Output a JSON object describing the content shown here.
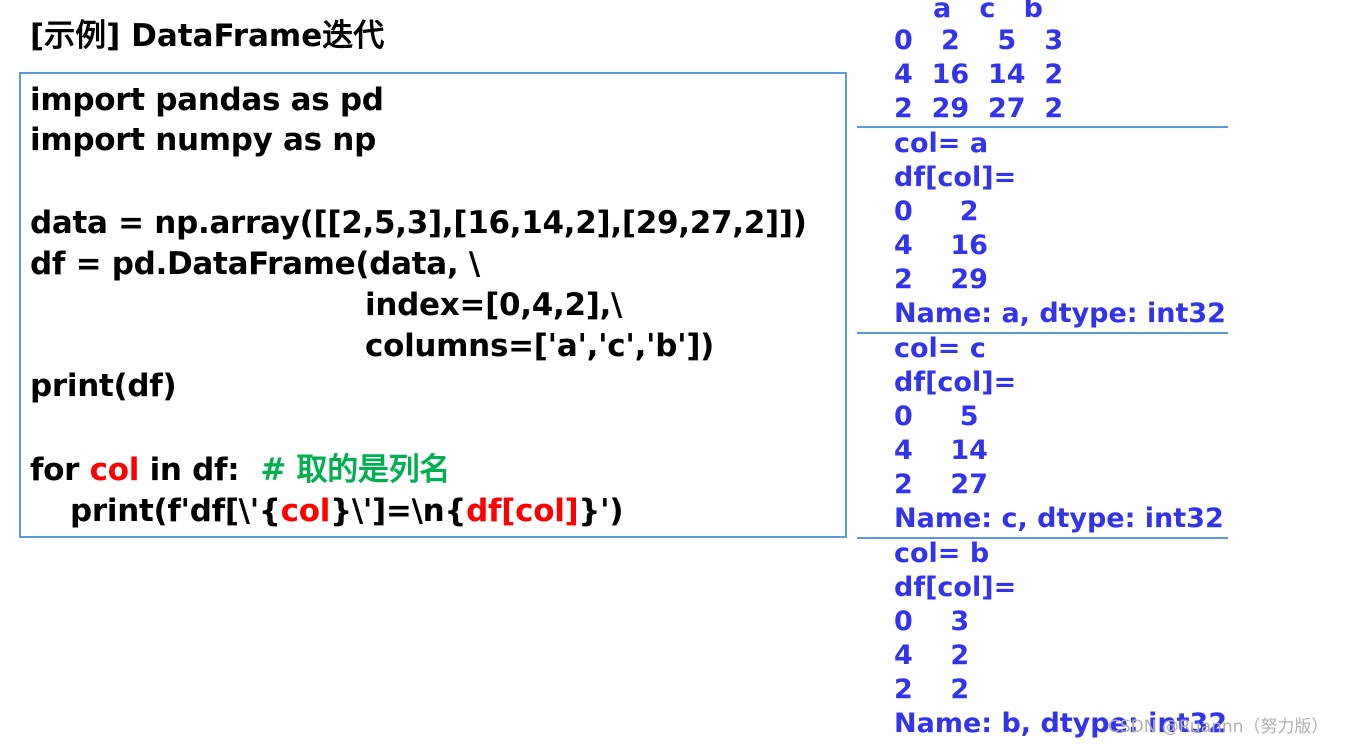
{
  "title": "[示例] DataFrame迭代",
  "code": {
    "line1": "import pandas as pd",
    "line2": "import numpy as np",
    "line3": "data = np.array([[2,5,3],[16,14,2],[29,27,2]])",
    "line4": "df = pd.DataFrame(data, \\",
    "line5": "index=[0,4,2],\\",
    "line6": "columns=['a','c','b'])",
    "line7": "print(df)",
    "line8": {
      "kw_for": "for ",
      "var": "col",
      "mid": " in df:  ",
      "comment": "# 取的是列名"
    },
    "line9": {
      "p1": "print(f'df[\\'{",
      "p2": "col",
      "p3": "}\\']=\\n{",
      "p4": "df[col]",
      "p5": "}')"
    }
  },
  "output": {
    "df_header": "a   c   b",
    "df_rows": [
      "0   2    5   3",
      "4  16  14  2",
      "2  29  27  2"
    ],
    "blocks": [
      {
        "col_line": "col= a",
        "df_line": "df[col]=",
        "rows": [
          "0     2",
          "4    16",
          "2    29"
        ],
        "name_line": "Name: a, dtype: int32"
      },
      {
        "col_line": "col= c",
        "df_line": "df[col]=",
        "rows": [
          "0     5",
          "4    14",
          "2    27"
        ],
        "name_line": "Name: c, dtype: int32"
      },
      {
        "col_line": "col= b",
        "df_line": "df[col]=",
        "rows": [
          "0    3",
          "4    2",
          "2    2"
        ],
        "name_line": "Name: b, dtype: int32"
      }
    ]
  },
  "watermark": "CSDN @Ruannn（努力版）",
  "colors": {
    "output_text": "#3333ee",
    "highlight_red": "#ff0000",
    "comment_green": "#00b050",
    "box_border": "#5b9bd5"
  }
}
